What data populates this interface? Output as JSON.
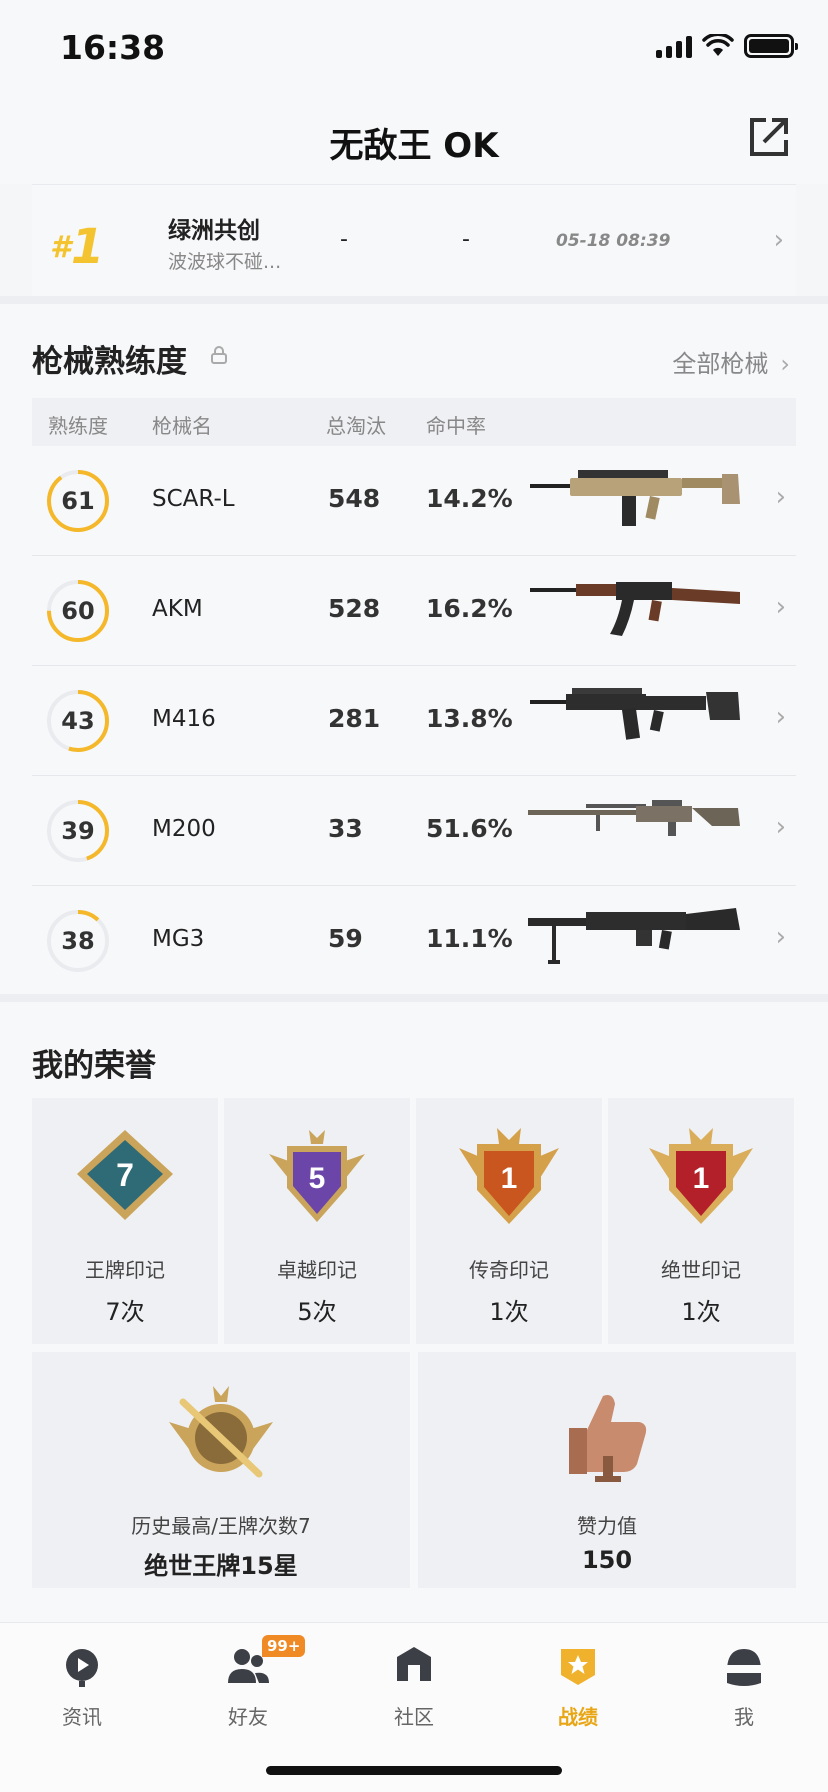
{
  "status_bar": {
    "time": "16:38"
  },
  "header": {
    "title": "无敌王 OK"
  },
  "rank": {
    "position": "1",
    "team_name": "绿洲共创",
    "team_sub": "波波球不碰...",
    "col1": "-",
    "col2": "-",
    "time": "05-18 08:39"
  },
  "guns": {
    "title": "枪械熟练度",
    "all_label": "全部枪械",
    "headers": {
      "proficiency": "熟练度",
      "name": "枪械名",
      "kills": "总淘汰",
      "accuracy": "命中率"
    },
    "rows": [
      {
        "level": "61",
        "progress": 0.9,
        "name": "SCAR-L",
        "kills": "548",
        "accuracy": "14.2%"
      },
      {
        "level": "60",
        "progress": 0.75,
        "name": "AKM",
        "kills": "528",
        "accuracy": "16.2%"
      },
      {
        "level": "43",
        "progress": 0.55,
        "name": "M416",
        "kills": "281",
        "accuracy": "13.8%"
      },
      {
        "level": "39",
        "progress": 0.45,
        "name": "M200",
        "kills": "33",
        "accuracy": "51.6%"
      },
      {
        "level": "38",
        "progress": 0.12,
        "name": "MG3",
        "kills": "59",
        "accuracy": "11.1%"
      }
    ]
  },
  "honors": {
    "title": "我的荣誉",
    "cards": [
      {
        "label": "王牌印记",
        "count": "7次",
        "number": "7",
        "color": "#2f6a77"
      },
      {
        "label": "卓越印记",
        "count": "5次",
        "number": "5",
        "color": "#6b46a8"
      },
      {
        "label": "传奇印记",
        "count": "1次",
        "number": "1",
        "color": "#c8561e"
      },
      {
        "label": "绝世印记",
        "count": "1次",
        "number": "1",
        "color": "#b3202a"
      }
    ],
    "highest": {
      "label": "历史最高/王牌次数7",
      "value": "绝世王牌15星"
    },
    "likes": {
      "label": "赞力值",
      "value": "150"
    }
  },
  "tabs": [
    {
      "label": "资讯",
      "icon": "news-icon"
    },
    {
      "label": "好友",
      "icon": "friends-icon",
      "badge": "99+"
    },
    {
      "label": "社区",
      "icon": "community-icon"
    },
    {
      "label": "战绩",
      "icon": "record-icon",
      "active": true
    },
    {
      "label": "我",
      "icon": "profile-icon"
    }
  ],
  "colors": {
    "accent": "#f4b82a",
    "active_tab": "#e8a614",
    "badge": "#f08a24"
  }
}
